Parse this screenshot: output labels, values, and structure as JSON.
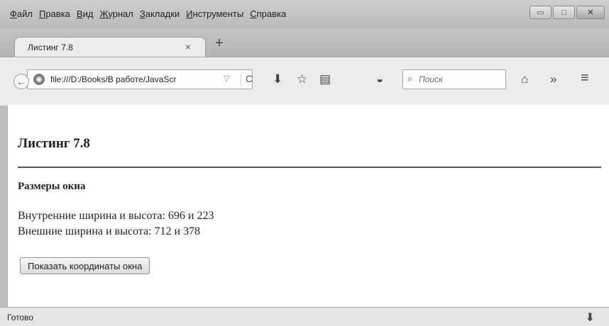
{
  "menubar": {
    "items": [
      "Файл",
      "Правка",
      "Вид",
      "Журнал",
      "Закладки",
      "Инструменты",
      "Справка"
    ]
  },
  "window_controls": {
    "minimize": "▭",
    "maximize": "□",
    "close": "✕"
  },
  "tab": {
    "title": "Листинг 7.8",
    "close_glyph": "×",
    "new_tab_glyph": "+"
  },
  "navbar": {
    "url": "file:///D:/Books/В работе/JavaScr",
    "search_placeholder": "Поиск",
    "icons": [
      "back-icon",
      "globe-icon",
      "dropdown-icon",
      "reload-icon",
      "download-icon",
      "bookmark-star-icon",
      "reading-list-icon",
      "pocket-icon",
      "search-icon",
      "home-icon",
      "overflow-icon",
      "menu-icon"
    ]
  },
  "page": {
    "heading": "Листинг 7.8",
    "subheading": "Размеры окна",
    "inner_size": "Внутренние ширина и высота: 696 и 223",
    "outer_size": "Внешние ширина и высота: 712 и 378",
    "button_label": "Показать координаты окна"
  },
  "statusbar": {
    "text": "Готово"
  }
}
